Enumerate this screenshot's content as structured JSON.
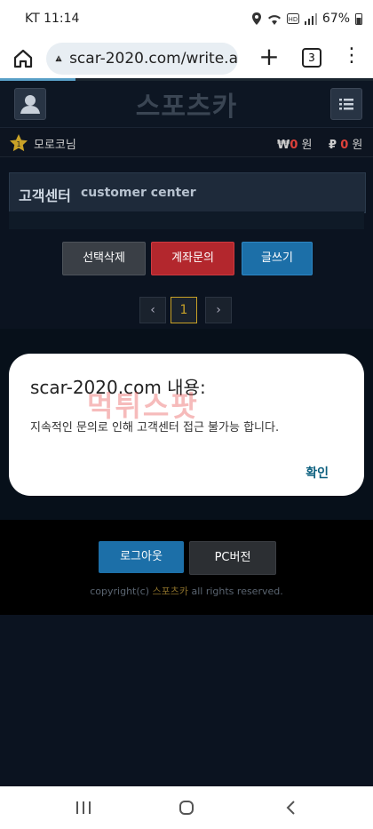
{
  "status": {
    "carrier": "KT",
    "time": "11:14",
    "battery": "67%"
  },
  "browser": {
    "url": "scar-2020.com/write.a",
    "tab_count": "3"
  },
  "header": {
    "logo": "스포츠카"
  },
  "user": {
    "name": "모로코님",
    "won_symbol": "₩",
    "won_value": "0",
    "won_unit": "원",
    "point_symbol": "₽",
    "point_value": "0",
    "point_unit": "원"
  },
  "board": {
    "title_ko": "고객센터",
    "title_en": "customer center"
  },
  "actions": {
    "delete": "선택삭제",
    "account_inquiry": "계좌문의",
    "write": "글쓰기"
  },
  "pagination": {
    "prev": "‹",
    "current": "1",
    "next": "›"
  },
  "dialog": {
    "title": "scar-2020.com 내용:",
    "message": "지속적인 문의로 인해 고객센터 접근 불가능 합니다.",
    "ok": "확인"
  },
  "watermark": "먹튀스팟",
  "footer": {
    "logout": "로그아웃",
    "pc_version": "PC버전",
    "copyright_prefix": "copyright(c)",
    "copyright_brand": "스포츠카",
    "copyright_suffix": "all rights reserved."
  },
  "colors": {
    "red": "#b3272d",
    "blue": "#1c6fa8",
    "gold": "#c9a227"
  }
}
